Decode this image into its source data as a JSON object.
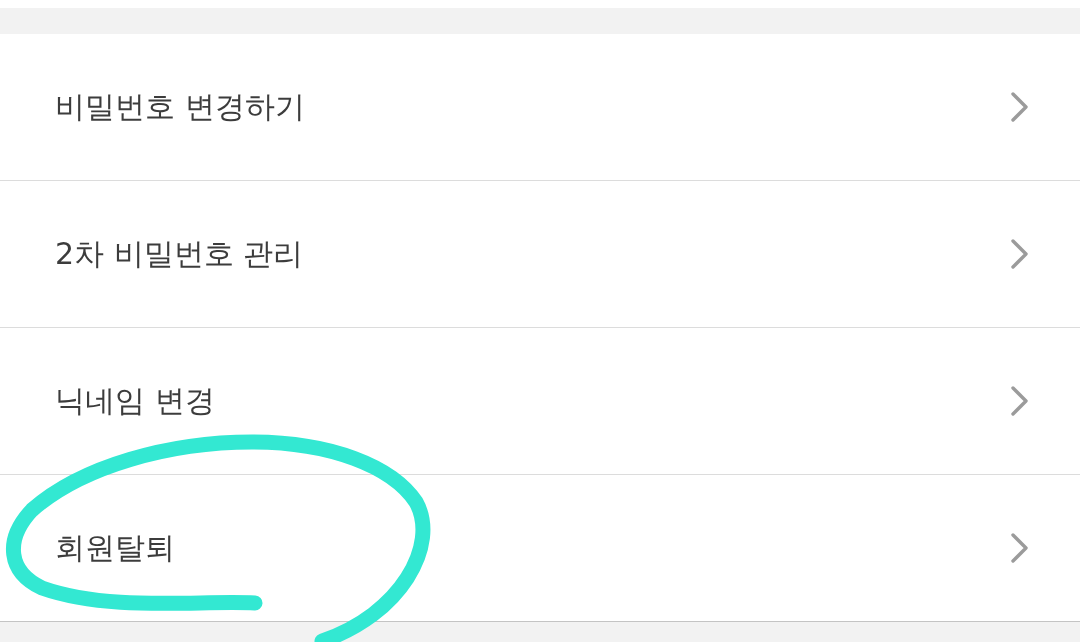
{
  "menu": {
    "items": [
      {
        "label": "비밀번호 변경하기",
        "circled": false
      },
      {
        "label": "2차 비밀번호 관리",
        "circled": false
      },
      {
        "label": "닉네임 변경",
        "circled": false
      },
      {
        "label": "회원탈퇴",
        "circled": true
      }
    ]
  }
}
